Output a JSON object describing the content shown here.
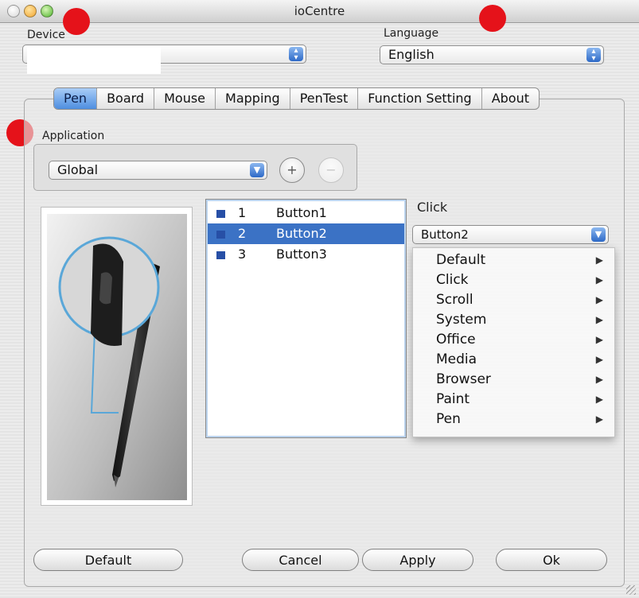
{
  "window": {
    "title": "ioCentre"
  },
  "device": {
    "label": "Device",
    "value": ""
  },
  "language": {
    "label": "Language",
    "value": "English"
  },
  "tabs": [
    "Pen",
    "Board",
    "Mouse",
    "Mapping",
    "PenTest",
    "Function Setting",
    "About"
  ],
  "active_tab": "Pen",
  "application": {
    "label": "Application",
    "value": "Global",
    "add": "+",
    "remove": "−"
  },
  "buttons_list": [
    {
      "num": "1",
      "name": "Button1"
    },
    {
      "num": "2",
      "name": "Button2"
    },
    {
      "num": "3",
      "name": "Button3"
    }
  ],
  "selected_button": "2",
  "click": {
    "label": "Click",
    "value": "Button2"
  },
  "menu_items": [
    "Default",
    "Click",
    "Scroll",
    "System",
    "Office",
    "Media",
    "Browser",
    "Paint",
    "Pen"
  ],
  "footer": {
    "default": "Default",
    "cancel": "Cancel",
    "apply": "Apply",
    "ok": "Ok"
  },
  "colors": {
    "selection": "#3b72c5",
    "accent_blue": "#4e8ee0",
    "marker_red": "#e5121a"
  }
}
